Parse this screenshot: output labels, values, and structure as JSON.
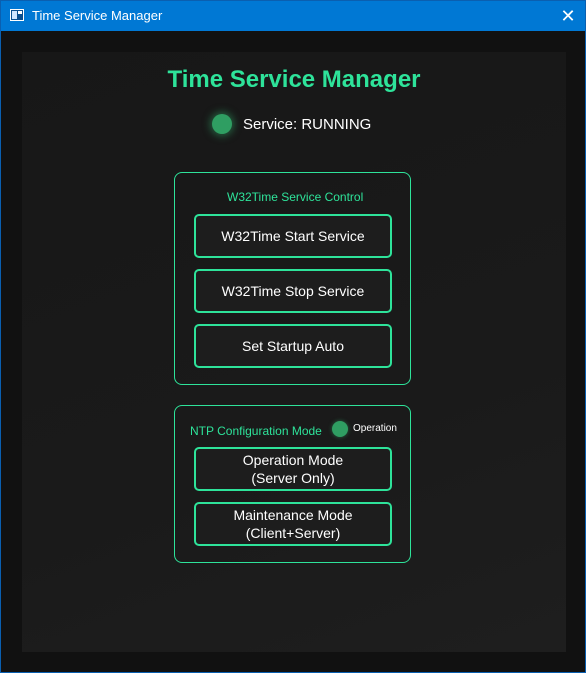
{
  "window": {
    "title": "Time Service Manager",
    "close_glyph": "✕"
  },
  "header": {
    "title": "Time Service Manager",
    "status_text": "Service: RUNNING"
  },
  "service_control": {
    "title": "W32Time Service Control",
    "buttons": [
      "W32Time Start Service",
      "W32Time Stop Service",
      "Set Startup Auto"
    ]
  },
  "ntp_config": {
    "title": "NTP Configuration Mode",
    "indicator_label": "Operation",
    "operation_button": {
      "line1": "Operation Mode",
      "line2": "(Server Only)"
    },
    "maintenance_button": {
      "line1": "Maintenance Mode",
      "line2": "(Client+Server)"
    }
  },
  "colors": {
    "accent": "#2ee39a",
    "status_green": "#2f9e62",
    "titlebar": "#0078d4",
    "background": "#111111"
  },
  "icons": {
    "app": "app-window-icon",
    "close": "close-icon",
    "status": "status-led-icon"
  }
}
